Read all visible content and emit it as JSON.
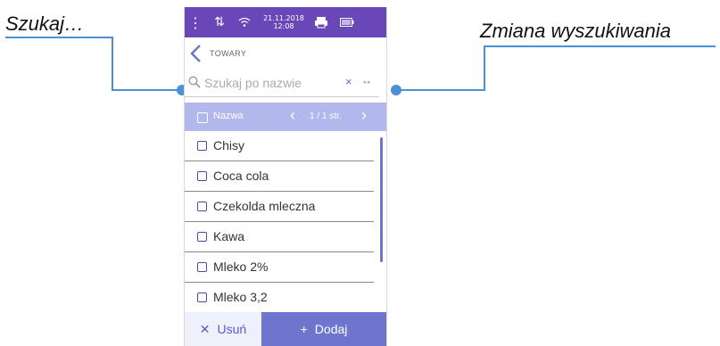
{
  "callouts": {
    "left": "Szukaj…",
    "right": "Zmiana wyszukiwania"
  },
  "statusbar": {
    "date": "21.11.2018",
    "time": "12:08",
    "icons": [
      "menu-dots-icon",
      "usb-icon",
      "wifi-icon",
      "printer-icon",
      "battery-icon"
    ]
  },
  "header": {
    "title": "TOWARY"
  },
  "search": {
    "placeholder": "Szukaj po nazwie",
    "clear_glyph": "×",
    "switch_glyph": "↔"
  },
  "list_header": {
    "label": "Nazwa",
    "pages": "1 / 1 str."
  },
  "items": [
    {
      "label": "Chisy"
    },
    {
      "label": "Coca cola"
    },
    {
      "label": "Czekolda mleczna"
    },
    {
      "label": "Kawa"
    },
    {
      "label": "Mleko 2%"
    },
    {
      "label": "Mleko 3,2"
    }
  ],
  "buttons": {
    "delete_label": "Usuń",
    "add_label": "Dodaj"
  },
  "colors": {
    "accent": "#6a47b8",
    "list_header": "#b2b8ec",
    "primary_button": "#6f75cc",
    "callout_line": "#4a90d9"
  }
}
